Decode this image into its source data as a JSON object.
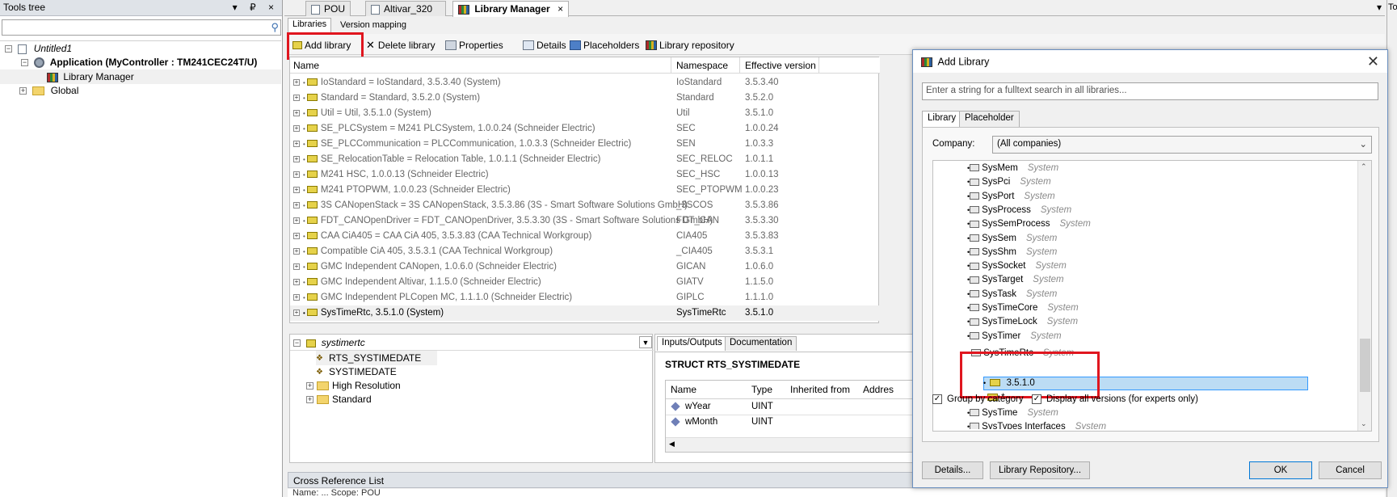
{
  "tools_tree": {
    "title": "Tools tree",
    "header_buttons": "▾ ₽ ×",
    "search_placeholder": "",
    "items": [
      {
        "label": "Untitled1",
        "expander": "−"
      },
      {
        "label": "Application (MyController : TM241CEC24T/U)",
        "expander": "−"
      },
      {
        "label": "Library Manager"
      },
      {
        "label": "Global",
        "expander": "+"
      }
    ]
  },
  "right_edge": {
    "label": "Too"
  },
  "doc_tabs": [
    {
      "label": "POU"
    },
    {
      "label": "Altivar_320"
    },
    {
      "label": "Library Manager",
      "close": "×"
    }
  ],
  "doc_tab_dropdown": "▾",
  "sub_tabs": [
    {
      "label": "Libraries"
    },
    {
      "label": "Version mapping"
    }
  ],
  "toolbar": {
    "add_library": "Add library",
    "delete_library": "Delete library",
    "properties": "Properties",
    "details": "Details",
    "placeholders": "Placeholders",
    "library_repository": "Library repository"
  },
  "lib_grid": {
    "headers": {
      "name": "Name",
      "namespace": "Namespace",
      "version": "Effective version"
    },
    "rows": [
      {
        "name": "IoStandard = IoStandard, 3.5.3.40 (System)",
        "ns": "IoStandard",
        "ver": "3.5.3.40"
      },
      {
        "name": "Standard = Standard, 3.5.2.0 (System)",
        "ns": "Standard",
        "ver": "3.5.2.0"
      },
      {
        "name": "Util = Util, 3.5.1.0 (System)",
        "ns": "Util",
        "ver": "3.5.1.0"
      },
      {
        "name": "SE_PLCSystem = M241 PLCSystem, 1.0.0.24 (Schneider Electric)",
        "ns": "SEC",
        "ver": "1.0.0.24"
      },
      {
        "name": "SE_PLCCommunication = PLCCommunication, 1.0.3.3 (Schneider Electric)",
        "ns": "SEN",
        "ver": "1.0.3.3"
      },
      {
        "name": "SE_RelocationTable = Relocation Table, 1.0.1.1 (Schneider Electric)",
        "ns": "SEC_RELOC",
        "ver": "1.0.1.1"
      },
      {
        "name": "M241 HSC, 1.0.0.13 (Schneider Electric)",
        "ns": "SEC_HSC",
        "ver": "1.0.0.13"
      },
      {
        "name": "M241 PTOPWM, 1.0.0.23 (Schneider Electric)",
        "ns": "SEC_PTOPWM",
        "ver": "1.0.0.23"
      },
      {
        "name": "3S CANopenStack = 3S CANopenStack, 3.5.3.86 (3S - Smart Software Solutions GmbH)",
        "ns": "_3SCOS",
        "ver": "3.5.3.86"
      },
      {
        "name": "FDT_CANOpenDriver = FDT_CANOpenDriver, 3.5.3.30 (3S - Smart Software Solutions GmbH)",
        "ns": "FDT_CAN",
        "ver": "3.5.3.30"
      },
      {
        "name": "CAA CiA405 = CAA CiA 405, 3.5.3.83 (CAA Technical Workgroup)",
        "ns": "CIA405",
        "ver": "3.5.3.83"
      },
      {
        "name": "Compatible CiA 405, 3.5.3.1 (CAA Technical Workgroup)",
        "ns": "_CIA405",
        "ver": "3.5.3.1"
      },
      {
        "name": "GMC Independent CANopen, 1.0.6.0 (Schneider Electric)",
        "ns": "GICAN",
        "ver": "1.0.6.0"
      },
      {
        "name": "GMC Independent Altivar, 1.1.5.0 (Schneider Electric)",
        "ns": "GIATV",
        "ver": "1.1.5.0"
      },
      {
        "name": "GMC Independent PLCopen MC, 1.1.1.0 (Schneider Electric)",
        "ns": "GIPLC",
        "ver": "1.1.1.0"
      },
      {
        "name": "SysTimeRtc, 3.5.1.0 (System)",
        "ns": "SysTimeRtc",
        "ver": "3.5.1.0"
      }
    ]
  },
  "bottom_tree": {
    "root": "systimertc",
    "items": [
      "RTS_SYSTIMEDATE",
      "SYSTIMEDATE",
      "High Resolution",
      "Standard"
    ]
  },
  "io_pane": {
    "tabs": [
      "Inputs/Outputs",
      "Documentation"
    ],
    "struct_title": "STRUCT  RTS_SYSTIMEDATE",
    "headers": [
      "Name",
      "Type",
      "Inherited from",
      "Addres"
    ],
    "rows": [
      {
        "name": "wYear",
        "type": "UINT"
      },
      {
        "name": "wMonth",
        "type": "UINT"
      }
    ]
  },
  "xref": {
    "title": "Cross Reference List",
    "sub": "Name:   ...                          Scope:  POU"
  },
  "dialog": {
    "title": "Add Library",
    "close": "✕",
    "search_placeholder": "Enter a string for a fulltext search in all libraries...",
    "tabs": [
      "Library",
      "Placeholder"
    ],
    "company_label": "Company:",
    "company_value": "(All companies)",
    "items": [
      {
        "name": "SysMem",
        "cat": "System"
      },
      {
        "name": "SysPci",
        "cat": "System"
      },
      {
        "name": "SysPort",
        "cat": "System"
      },
      {
        "name": "SysProcess",
        "cat": "System"
      },
      {
        "name": "SysSemProcess",
        "cat": "System"
      },
      {
        "name": "SysSem",
        "cat": "System"
      },
      {
        "name": "SysShm",
        "cat": "System"
      },
      {
        "name": "SysSocket",
        "cat": "System"
      },
      {
        "name": "SysTarget",
        "cat": "System"
      },
      {
        "name": "SysTask",
        "cat": "System"
      },
      {
        "name": "SysTimeCore",
        "cat": "System"
      },
      {
        "name": "SysTimeLock",
        "cat": "System"
      },
      {
        "name": "SysTimer",
        "cat": "System"
      },
      {
        "name": "SysTimeRtc",
        "cat": "System"
      }
    ],
    "version_selected": "3.5.1.0",
    "version_star": "*",
    "after_item": {
      "name": "SysTime",
      "cat": "System"
    },
    "cut_item": {
      "name": "SysTypes Interfaces",
      "cat": "System"
    },
    "group_by_category": "Group by category",
    "display_all_versions": "Display all versions (for experts only)",
    "details_btn": "Details...",
    "repo_btn": "Library Repository...",
    "ok_btn": "OK",
    "cancel_btn": "Cancel"
  },
  "colors": {
    "highlight": "#e0161f",
    "selection": "#bcdcf4"
  }
}
